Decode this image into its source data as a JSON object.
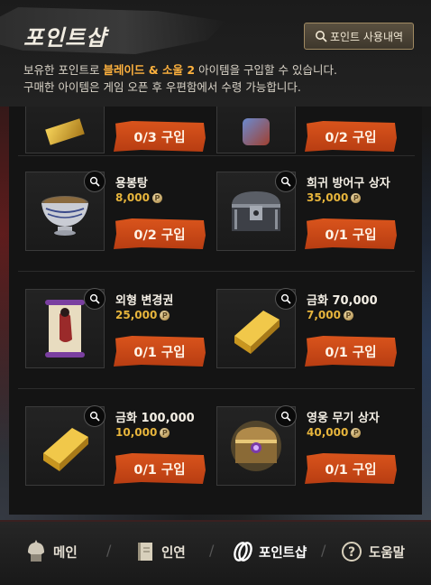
{
  "header": {
    "title": "포인트샵",
    "history_button": "포인트 사용내역",
    "desc_prefix": "보유한 포인트로 ",
    "desc_highlight": "블레이드 & 소울 2",
    "desc_suffix": " 아이템을 구입할 수 있습니다.",
    "desc_line2": "구매한 아이템은 게임 오픈 후 우편함에서 수령 가능합니다."
  },
  "top_row": [
    {
      "buy_label": "0/3 구입",
      "icon": "gold-bar-icon"
    },
    {
      "buy_label": "0/2 구입",
      "icon": "treasure-icon"
    }
  ],
  "items": [
    {
      "name": "용봉탕",
      "price": "8,000",
      "buy_label": "0/2 구입",
      "icon": "soup-bowl-icon"
    },
    {
      "name": "희귀 방어구 상자",
      "price": "35,000",
      "buy_label": "0/1 구입",
      "icon": "armor-chest-icon"
    },
    {
      "name": "외형 변경권",
      "price": "25,000",
      "buy_label": "0/1 구입",
      "icon": "scroll-icon"
    },
    {
      "name": "금화 70,000",
      "price": "7,000",
      "buy_label": "0/1 구입",
      "icon": "gold-bar-icon"
    },
    {
      "name": "금화 100,000",
      "price": "10,000",
      "buy_label": "0/1 구입",
      "icon": "gold-bar-icon"
    },
    {
      "name": "영웅 무기 상자",
      "price": "40,000",
      "buy_label": "0/1 구입",
      "icon": "weapon-chest-icon"
    }
  ],
  "point_symbol": "P",
  "tabs": [
    {
      "label": "메인",
      "icon": "helmet-icon"
    },
    {
      "label": "인연",
      "icon": "book-icon"
    },
    {
      "label": "포인트샵",
      "icon": "coins-icon",
      "active": true
    },
    {
      "label": "도움말",
      "icon": "question-icon"
    }
  ],
  "colors": {
    "accent": "#d9541c",
    "price": "#e7b53c",
    "highlight": "#ffb23e"
  }
}
